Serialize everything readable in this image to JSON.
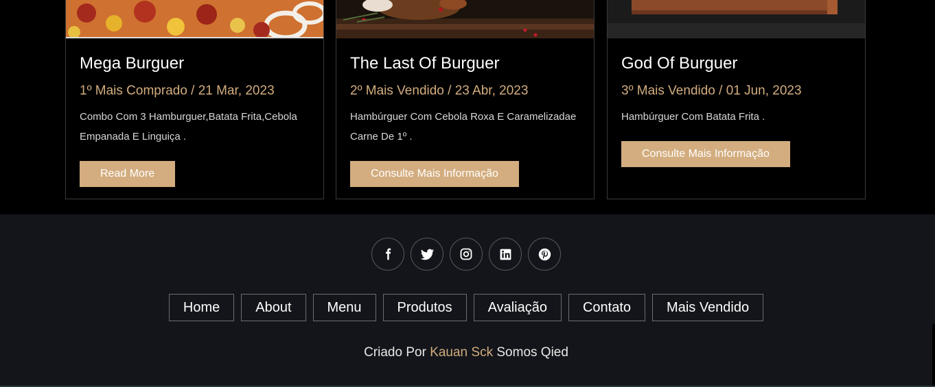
{
  "cards": [
    {
      "title": "Mega Burguer",
      "subtitle": "1º Mais Comprado / 21 Mar, 2023",
      "description": "Combo Com 3 Hamburguer,Batata Frita,Cebola Empanada E Linguiça .",
      "button": "Read More"
    },
    {
      "title": "The Last Of Burguer",
      "subtitle": "2º Mais Vendido / 23 Abr, 2023",
      "description": "Hambúrguer Com Cebola Roxa E Caramelizadae Carne De 1º .",
      "button": "Consulte Mais Informação"
    },
    {
      "title": "God Of Burguer",
      "subtitle": "3º Mais Vendido / 01 Jun, 2023",
      "description": "Hambúrguer Com Batata Frita .",
      "button": "Consulte Mais Informação"
    }
  ],
  "footer": {
    "socials": [
      "facebook-icon",
      "twitter-icon",
      "instagram-icon",
      "linkedin-icon",
      "pinterest-icon"
    ],
    "links": [
      "Home",
      "About",
      "Menu",
      "Produtos",
      "Avaliação",
      "Contato",
      "Mais Vendido"
    ],
    "credit_prefix": "Criado Por",
    "credit_author": "Kauan Sck",
    "credit_suffix": "Somos Qied"
  },
  "colors": {
    "accent": "#d3ad7f",
    "footer_bg": "#13151a",
    "page_bg": "#000000"
  }
}
